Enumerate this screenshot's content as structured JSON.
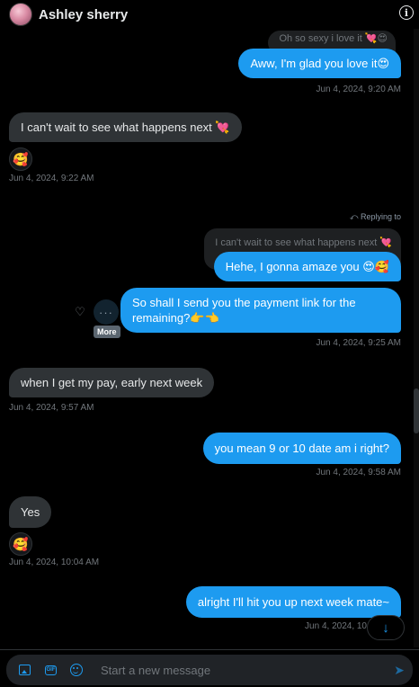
{
  "header": {
    "name": "Ashley sherry"
  },
  "messages": {
    "m0_quote": "Oh so sexy i love it 💘😍",
    "m1": "Aww, I'm glad you love it😍",
    "m1_time": "Jun 4, 2024, 9:20 AM",
    "m2": "I can't wait to see what happens next 💘",
    "m2_reaction": "🥰",
    "m2_time": "Jun 4, 2024, 9:22 AM",
    "reply_label": "Replying to",
    "m3_quote": "I can't wait to see what happens next 💘",
    "m3": "Hehe, I gonna amaze you 😍🥰",
    "m4_line1": "So shall I send you the payment link for the",
    "m4_line2": "remaining?👉👈",
    "m4_time": "Jun 4, 2024, 9:25 AM",
    "more_tooltip": "More",
    "m5": "when I get my pay, early next week",
    "m5_time": "Jun 4, 2024, 9:57 AM",
    "m6": "you mean 9 or 10 date am i right?",
    "m6_time": "Jun 4, 2024, 9:58 AM",
    "m7": "Yes",
    "m7_reaction": "🥰",
    "m7_time": "Jun 4, 2024, 10:04 AM",
    "m8": "alright I'll hit you up next week mate~",
    "m8_time": "Jun 4, 2024, 10"
  },
  "composer": {
    "placeholder": "Start a new message"
  },
  "colors": {
    "accent": "#1d9bf0",
    "incoming": "#2f3336",
    "background": "#000000"
  },
  "icons": [
    "info-icon",
    "heart-plus-icon",
    "more-icon",
    "arrow-down-icon",
    "image-icon",
    "gif-icon",
    "emoji-icon",
    "send-icon"
  ]
}
